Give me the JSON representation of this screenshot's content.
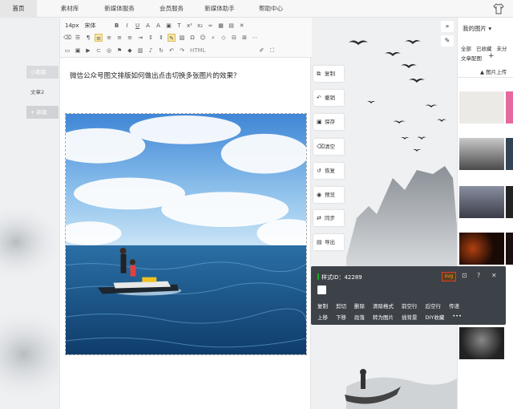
{
  "nav": {
    "items": [
      "首页",
      "素材库",
      "新媒体服务",
      "会员服务",
      "新媒体助手",
      "帮助中心"
    ],
    "active": 0
  },
  "doc_list": {
    "active_label": "小都都",
    "second_label": "文章2",
    "add_label": "+ 新建"
  },
  "toolbar": {
    "font_size": "14px",
    "font_family": "宋体",
    "html_label": "HTML"
  },
  "editor": {
    "title": "微信公众号图文排版如何做出点击切换多张图片的效果？"
  },
  "actions": [
    {
      "icon": "copy-icon",
      "label": "复制"
    },
    {
      "icon": "undo-icon",
      "label": "撤销"
    },
    {
      "icon": "save-icon",
      "label": "保存"
    },
    {
      "icon": "clear-icon",
      "label": "清空"
    },
    {
      "icon": "restore-icon",
      "label": "恢复"
    },
    {
      "icon": "preview-icon",
      "label": "预览"
    },
    {
      "icon": "sync-icon",
      "label": "同步"
    },
    {
      "icon": "export-icon",
      "label": "导出"
    }
  ],
  "right_panel": {
    "title": "我的图片",
    "filters": [
      "全部",
      "已收藏",
      "未分"
    ],
    "sub": "文章配图",
    "upload": "图片上传"
  },
  "popup": {
    "style_id_label": "样式ID：42289",
    "svg_label": "svg",
    "row1": [
      "复制",
      "剪切",
      "删除",
      "清除格式",
      "前空行",
      "后空行",
      "传递"
    ],
    "row2": [
      "上移",
      "下移",
      "段落",
      "转为图片",
      "插背景",
      "DIY收藏",
      "•••"
    ]
  },
  "colors": {
    "popup_bg": "#3d4148",
    "accent_green": "#1aad19",
    "svg_border": "#e23b2e"
  }
}
